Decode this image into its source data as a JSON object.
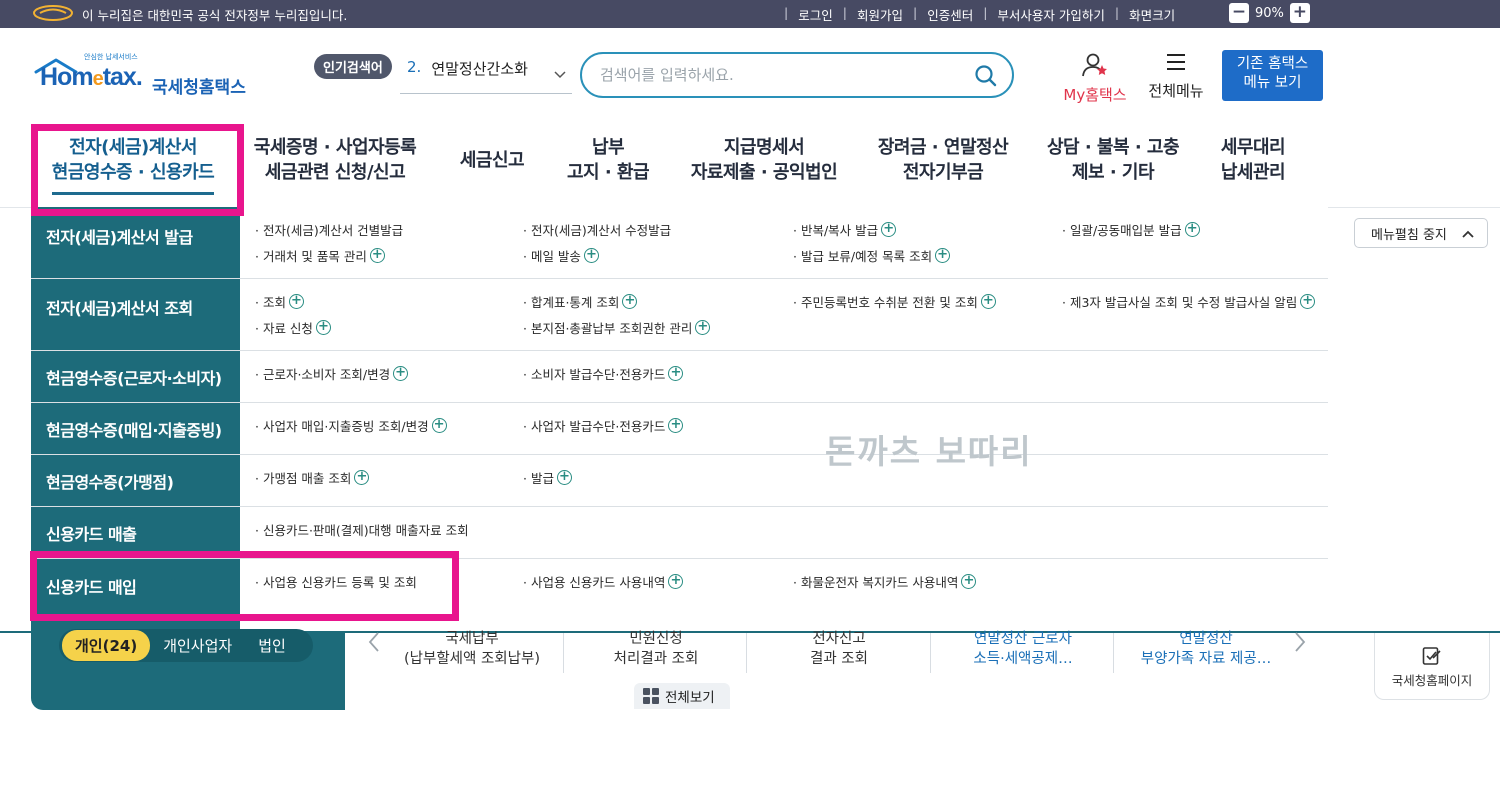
{
  "gov_bar": {
    "text": "이 누리집은 대한민국 공식 전자정부 누리집입니다.",
    "links": [
      "로그인",
      "회원가입",
      "인증센터",
      "부서사용자 가입하기",
      "화면크기"
    ],
    "zoom": "90%",
    "minus": "−",
    "plus": "+"
  },
  "logo": {
    "slogan": "안심한 납세서비스",
    "wordmark_a": "Hom",
    "wordmark_e": "e",
    "wordmark_b": "tax.",
    "name": "국세청홈택스"
  },
  "header": {
    "popular_label": "인기검색어",
    "popular_num": "2.",
    "popular_term": "연말정산간소화",
    "search_placeholder": "검색어를 입력하세요.",
    "my_hometax": "My홈택스",
    "all_menu": "전체메뉴",
    "old_menu_line1": "기존 홈택스",
    "old_menu_line2": "메뉴 보기"
  },
  "main_nav": [
    {
      "l1": "전자(세금)계산서",
      "l2": "현금영수증 · 신용카드"
    },
    {
      "l1": "국세증명 · 사업자등록",
      "l2": "세금관련 신청/신고"
    },
    {
      "l1": "세금신고",
      "l2": ""
    },
    {
      "l1": "납부",
      "l2": "고지 · 환급"
    },
    {
      "l1": "지급명세서",
      "l2": "자료제출 · 공익법인"
    },
    {
      "l1": "장려금 · 연말정산",
      "l2": "전자기부금"
    },
    {
      "l1": "상담 · 불복 · 고충",
      "l2": "제보 · 기타"
    },
    {
      "l1": "세무대리",
      "l2": "납세관리"
    }
  ],
  "mega_menu": {
    "rows": [
      {
        "category": "전자(세금)계산서 발급",
        "links": [
          {
            "text": "· 전자(세금)계산서 건별발급",
            "plus": false
          },
          {
            "text": "· 전자(세금)계산서 수정발급",
            "plus": false
          },
          {
            "text": "· 반복/복사 발급",
            "plus": true
          },
          {
            "text": "· 일괄/공동매입분 발급",
            "plus": true
          },
          {
            "text": "· 거래처 및 품목 관리",
            "plus": true
          },
          {
            "text": "· 메일 발송",
            "plus": true
          },
          {
            "text": "· 발급 보류/예정 목록 조회",
            "plus": true
          }
        ]
      },
      {
        "category": "전자(세금)계산서 조회",
        "links": [
          {
            "text": "· 조회",
            "plus": true
          },
          {
            "text": "· 합계표·통계 조회",
            "plus": true
          },
          {
            "text": "· 주민등록번호 수취분 전환 및 조회",
            "plus": true
          },
          {
            "text": "· 제3자 발급사실 조회 및 수정 발급사실 알림",
            "plus": true
          },
          {
            "text": "· 자료 신청",
            "plus": true
          },
          {
            "text": "· 본지점·총괄납부 조회권한 관리",
            "plus": true
          }
        ]
      },
      {
        "category": "현금영수증(근로자·소비자)",
        "links": [
          {
            "text": "· 근로자·소비자 조회/변경",
            "plus": true
          },
          {
            "text": "· 소비자 발급수단·전용카드",
            "plus": true
          }
        ]
      },
      {
        "category": "현금영수증(매입·지출증빙)",
        "links": [
          {
            "text": "· 사업자 매입·지출증빙 조회/변경",
            "plus": true
          },
          {
            "text": "· 사업자 발급수단·전용카드",
            "plus": true
          }
        ]
      },
      {
        "category": "현금영수증(가맹점)",
        "links": [
          {
            "text": "· 가맹점 매출 조회",
            "plus": true
          },
          {
            "text": "· 발급",
            "plus": true
          }
        ]
      },
      {
        "category": "신용카드 매출",
        "links": [
          {
            "text": "· 신용카드·판매(결제)대행 매출자료 조회",
            "plus": false
          }
        ]
      },
      {
        "category": "신용카드 매입",
        "links": [
          {
            "text": "· 사업용 신용카드 등록 및 조회",
            "plus": false
          },
          {
            "text": "· 사업용 신용카드 사용내역",
            "plus": true
          },
          {
            "text": "· 화물운전자 복지카드 사용내역",
            "plus": true
          }
        ]
      }
    ],
    "watermark": "돈까츠 보따리",
    "stop_button": "메뉴펼침 중지"
  },
  "bottom": {
    "user_tabs": [
      {
        "label": "개인(24)"
      },
      {
        "label": "개인사업자"
      },
      {
        "label": "법인"
      }
    ],
    "quick_items": [
      {
        "l1": "국세납부",
        "l2": "(납부할세액 조회납부)"
      },
      {
        "l1": "민원신청",
        "l2": "처리결과 조회"
      },
      {
        "l1": "전자신고",
        "l2": "결과 조회"
      },
      {
        "l1": "연말정산 근로자",
        "l2": "소득·세액공제…"
      },
      {
        "l1": "연말정산",
        "l2": "부양가족 자료 제공…"
      }
    ],
    "view_all": "전체보기",
    "nts_page": "국세청홈페이지"
  },
  "colors": {
    "gov_bar": "#474a63",
    "menu_teal": "#1d6b7a",
    "highlight_pink": "#e8158d",
    "brand_blue": "#1b63b5",
    "old_menu_blue": "#1e6cc8",
    "active_tab_yellow": "#f5d24a"
  },
  "icons": [
    "gov-emblem-icon",
    "search-icon",
    "user-star-icon",
    "hamburger-icon",
    "chevron-down-icon",
    "chevron-up-icon",
    "plus-circle-icon",
    "grid-icon",
    "checklist-icon",
    "arrow-left-icon",
    "arrow-right-icon"
  ]
}
